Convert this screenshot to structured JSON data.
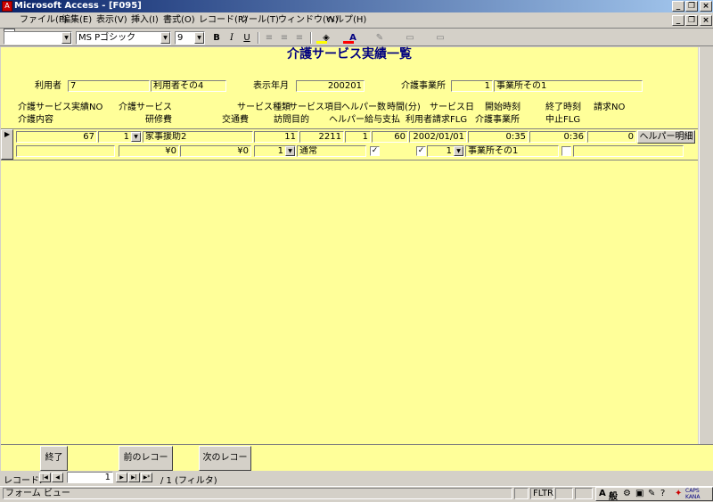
{
  "window": {
    "title": "Microsoft Access - [F095]",
    "icon": "access-app-icon"
  },
  "menu": [
    "ファイル(F)",
    "編集(E)",
    "表示(V)",
    "挿入(I)",
    "書式(O)",
    "レコード(R)",
    "ツール(T)",
    "ウィンドウ(W)",
    "ヘルプ(H)"
  ],
  "toolbar": {
    "object_combo": "",
    "font_name": "MS Pゴシック",
    "font_size": "9",
    "bold": "B",
    "italic": "I",
    "underline": "U",
    "fill_color": "#ffff00",
    "font_color": "#ff0000"
  },
  "form": {
    "title": "介護サービス実績一覧",
    "header": {
      "user_label": "利用者",
      "user_id": "7",
      "user_name": "利用者その4",
      "display_month_label": "表示年月",
      "display_month": "200201",
      "provider_label": "介護事業所",
      "provider_id": "1",
      "provider_name": "事業所その1"
    },
    "columns_row1": [
      "介護サービス実績NO",
      "介護サービス",
      "サービス種類",
      "サービス項目",
      "ヘルパー数",
      "時間(分)",
      "サービス日",
      "開始時刻",
      "終了時刻",
      "請求NO"
    ],
    "columns_row2": [
      "介護内容",
      "研修費",
      "交通費",
      "訪問目的",
      "ヘルパー給与支払",
      "利用者請求FLG",
      "介護事業所",
      "中止FLG"
    ],
    "record": {
      "service_no": "67",
      "care_service": "1",
      "care_service_name": "家事援助2",
      "service_type": "11",
      "service_item": "2211",
      "helper_count": "1",
      "minutes": "60",
      "service_date": "2002/01/01",
      "start_time": "0:35",
      "end_time": "0:36",
      "billing_no": "0",
      "helper_detail_button": "ヘルパー明細",
      "care_content": "",
      "training_fee": "¥0",
      "transport_fee": "¥0",
      "visit_purpose": "1",
      "visit_purpose_name": "通常",
      "helper_pay": true,
      "user_billing": true,
      "provider": "1",
      "provider_name": "事業所その1",
      "cancel": false
    }
  },
  "footer": {
    "close_button": "終了",
    "prev_button": "前のレコード",
    "next_button": "次のレコード"
  },
  "recordnav": {
    "label": "レコード:",
    "current": "1",
    "total_text": "/ 1 (フィルタ)"
  },
  "status": {
    "view": "フォーム ビュー",
    "filter": "FLTR",
    "caps": "CAPS",
    "kana": "KANA",
    "ime_mode": "般"
  }
}
